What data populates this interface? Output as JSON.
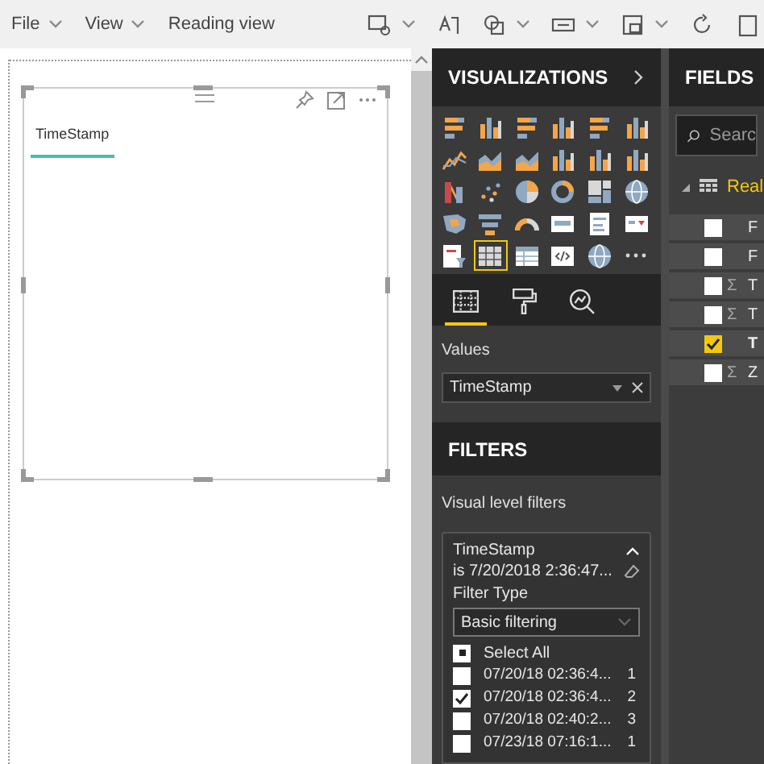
{
  "ribbon": {
    "menus": [
      {
        "label": "File",
        "dropdown": true
      },
      {
        "label": "View",
        "dropdown": true
      },
      {
        "label": "Reading view",
        "dropdown": false
      }
    ]
  },
  "canvas": {
    "visual": {
      "field_header": "TimeStamp"
    }
  },
  "visualizations": {
    "title": "VISUALIZATIONS",
    "visual_types": [
      {
        "kind": "hbar",
        "selected": false
      },
      {
        "kind": "col",
        "selected": false
      },
      {
        "kind": "hbar",
        "selected": false
      },
      {
        "kind": "col",
        "selected": false
      },
      {
        "kind": "hbar",
        "selected": false
      },
      {
        "kind": "col",
        "selected": false
      },
      {
        "kind": "line",
        "selected": false
      },
      {
        "kind": "area",
        "selected": false
      },
      {
        "kind": "area",
        "selected": false
      },
      {
        "kind": "col",
        "selected": false
      },
      {
        "kind": "col",
        "selected": false
      },
      {
        "kind": "col",
        "selected": false
      },
      {
        "kind": "ribbon",
        "selected": false
      },
      {
        "kind": "scatter",
        "selected": false
      },
      {
        "kind": "pie",
        "selected": false
      },
      {
        "kind": "donut",
        "selected": false
      },
      {
        "kind": "treemap",
        "selected": false
      },
      {
        "kind": "globe",
        "selected": false
      },
      {
        "kind": "map",
        "selected": false
      },
      {
        "kind": "funnel",
        "selected": false
      },
      {
        "kind": "gauge",
        "selected": false
      },
      {
        "kind": "card",
        "selected": false
      },
      {
        "kind": "list",
        "selected": false
      },
      {
        "kind": "kpi",
        "selected": false
      },
      {
        "kind": "slicer",
        "selected": false
      },
      {
        "kind": "table",
        "selected": true
      },
      {
        "kind": "matrix",
        "selected": false
      },
      {
        "kind": "code",
        "selected": false
      },
      {
        "kind": "globe",
        "selected": false
      },
      {
        "kind": "more",
        "selected": false
      }
    ],
    "pane_tabs": [
      {
        "kind": "fields",
        "selected": true
      },
      {
        "kind": "format",
        "selected": false
      },
      {
        "kind": "analytics",
        "selected": false
      }
    ],
    "values_label": "Values",
    "value_field": "TimeStamp"
  },
  "filters": {
    "title": "FILTERS",
    "section": "Visual level filters",
    "card": {
      "field": "TimeStamp",
      "summary": "is 7/20/2018 2:36:47...",
      "filter_type_label": "Filter Type",
      "filter_type": "Basic filtering",
      "select_all": {
        "label": "Select All",
        "partial": true
      },
      "items": [
        {
          "label": "07/20/18 02:36:4...",
          "count": "1",
          "checked": false
        },
        {
          "label": "07/20/18 02:36:4...",
          "count": "2",
          "checked": true
        },
        {
          "label": "07/20/18 02:40:2...",
          "count": "3",
          "checked": false
        },
        {
          "label": "07/23/18 07:16:1...",
          "count": "1",
          "checked": false
        }
      ]
    }
  },
  "fields": {
    "title": "FIELDS",
    "search": {
      "placeholder": "Searc"
    },
    "table": {
      "name": "Real",
      "expanded": true
    },
    "rows": [
      {
        "label": "F",
        "sigma": "",
        "checked": false
      },
      {
        "label": "F",
        "sigma": "",
        "checked": false
      },
      {
        "label": "T",
        "sigma": "Σ",
        "checked": false
      },
      {
        "label": "T",
        "sigma": "Σ",
        "checked": false
      },
      {
        "label": "T",
        "sigma": "",
        "checked": true
      },
      {
        "label": "Z",
        "sigma": "Σ",
        "checked": false
      }
    ]
  }
}
